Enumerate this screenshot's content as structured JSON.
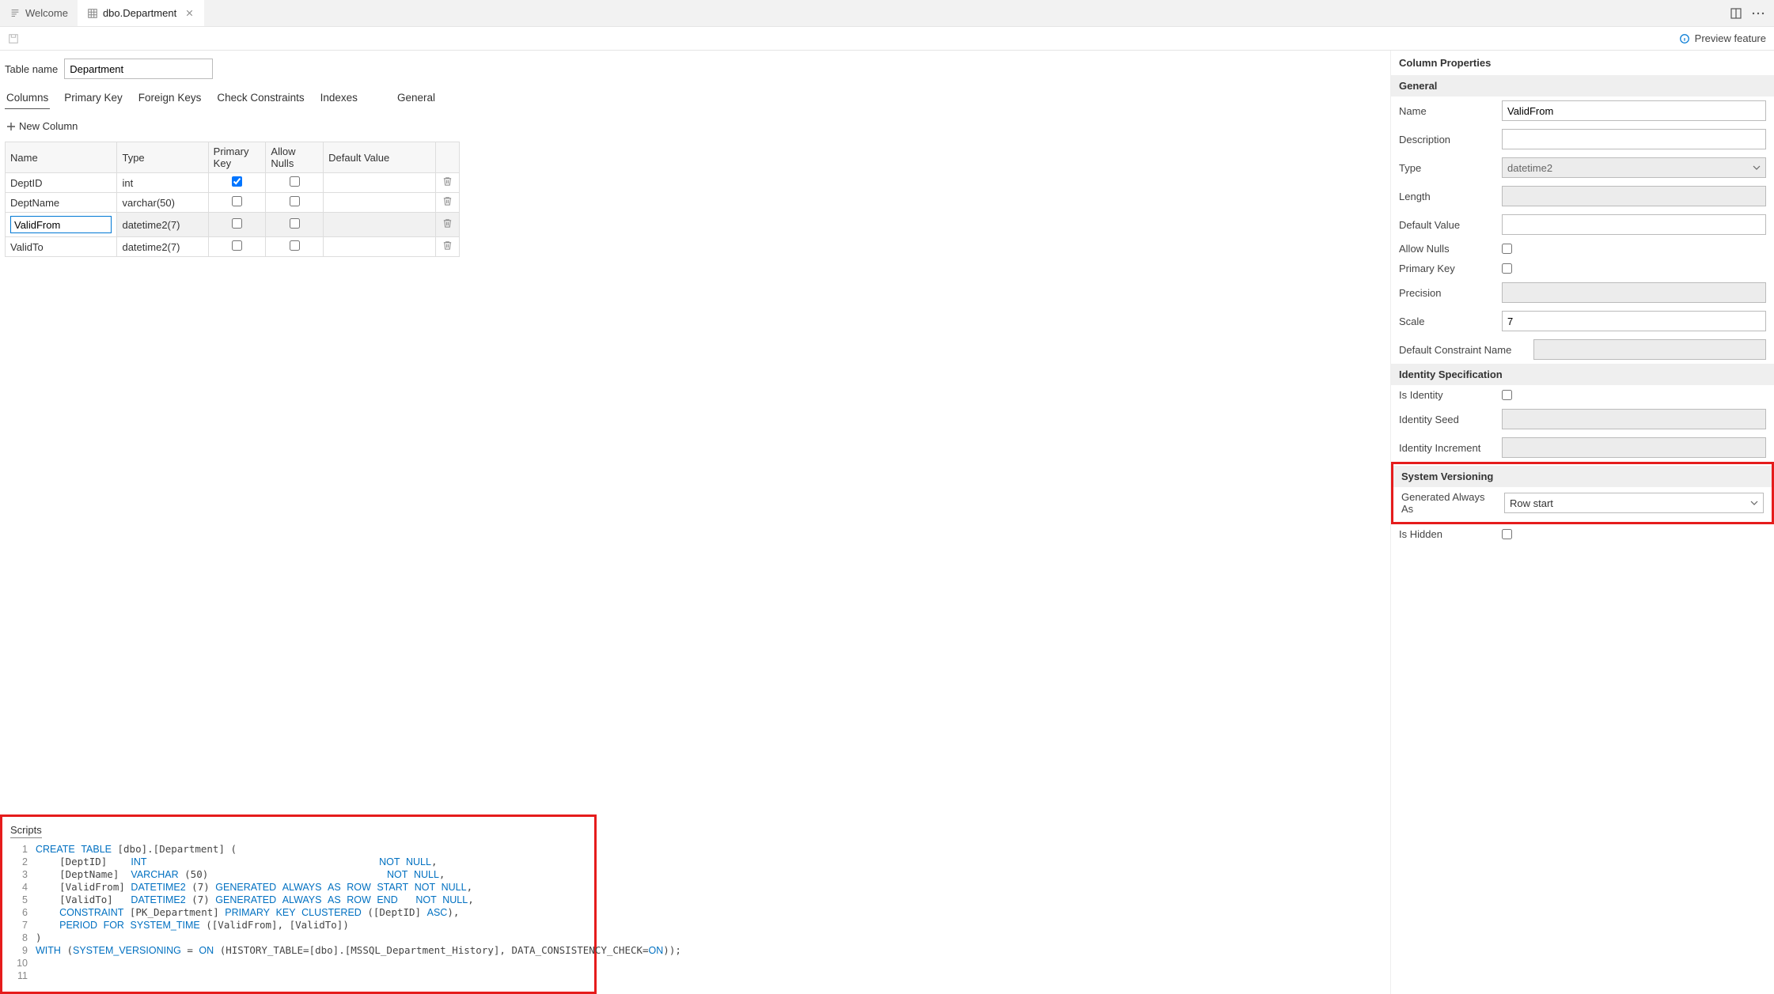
{
  "tabs": {
    "welcome": "Welcome",
    "current": "dbo.Department"
  },
  "preview_label": "Preview feature",
  "tablename_label": "Table name",
  "tablename_value": "Department",
  "designer_tabs": {
    "columns": "Columns",
    "pk": "Primary Key",
    "fk": "Foreign Keys",
    "cc": "Check Constraints",
    "idx": "Indexes",
    "gen": "General"
  },
  "newcol_label": "New Column",
  "cols_headers": {
    "name": "Name",
    "type": "Type",
    "pk": "Primary Key",
    "nulls": "Allow Nulls",
    "def": "Default Value"
  },
  "cols": [
    {
      "name": "DeptID",
      "type": "int",
      "pk": true,
      "nulls": false,
      "selected": false
    },
    {
      "name": "DeptName",
      "type": "varchar(50)",
      "pk": false,
      "nulls": false,
      "selected": false
    },
    {
      "name": "ValidFrom",
      "type": "datetime2(7)",
      "pk": false,
      "nulls": false,
      "selected": true
    },
    {
      "name": "ValidTo",
      "type": "datetime2(7)",
      "pk": false,
      "nulls": false,
      "selected": false
    }
  ],
  "scripts_title": "Scripts",
  "script_lines": [
    "CREATE TABLE [dbo].[Department] (",
    "    [DeptID]    INT                                       NOT NULL,",
    "    [DeptName]  VARCHAR (50)                              NOT NULL,",
    "    [ValidFrom] DATETIME2 (7) GENERATED ALWAYS AS ROW START NOT NULL,",
    "    [ValidTo]   DATETIME2 (7) GENERATED ALWAYS AS ROW END   NOT NULL,",
    "    CONSTRAINT [PK_Department] PRIMARY KEY CLUSTERED ([DeptID] ASC),",
    "    PERIOD FOR SYSTEM_TIME ([ValidFrom], [ValidTo])",
    ")",
    "WITH (SYSTEM_VERSIONING = ON (HISTORY_TABLE=[dbo].[MSSQL_Department_History], DATA_CONSISTENCY_CHECK=ON));",
    "",
    ""
  ],
  "props": {
    "panel_title": "Column Properties",
    "general_head": "General",
    "name_label": "Name",
    "name_value": "ValidFrom",
    "desc_label": "Description",
    "desc_value": "",
    "type_label": "Type",
    "type_value": "datetime2",
    "length_label": "Length",
    "length_value": "",
    "defval_label": "Default Value",
    "defval_value": "",
    "allownulls_label": "Allow Nulls",
    "allownulls_value": false,
    "pk_label": "Primary Key",
    "pk_value": false,
    "precision_label": "Precision",
    "precision_value": "",
    "scale_label": "Scale",
    "scale_value": "7",
    "defconst_label": "Default Constraint Name",
    "defconst_value": "",
    "identity_head": "Identity Specification",
    "isidentity_label": "Is Identity",
    "isidentity_value": false,
    "seed_label": "Identity Seed",
    "seed_value": "",
    "incr_label": "Identity Increment",
    "incr_value": "",
    "sysver_head": "System Versioning",
    "genalways_label": "Generated Always As",
    "genalways_value": "Row start",
    "ishidden_label": "Is Hidden",
    "ishidden_value": false
  }
}
